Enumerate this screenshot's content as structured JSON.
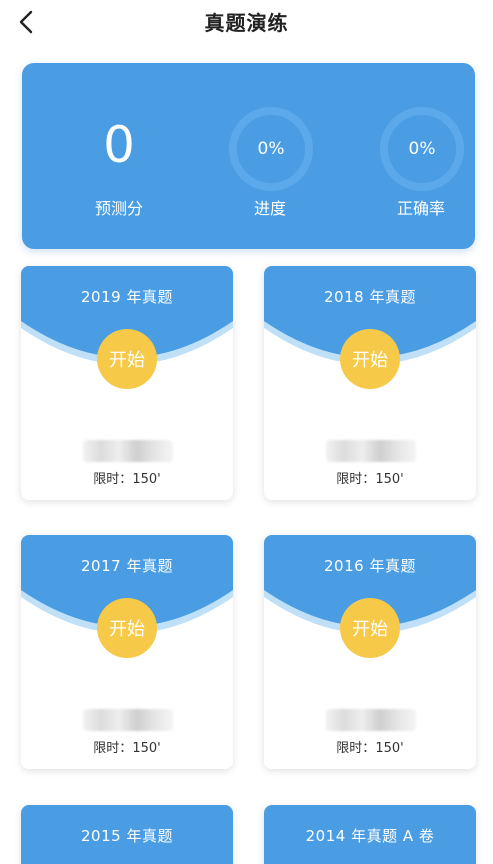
{
  "header": {
    "title": "真题演练"
  },
  "stats": {
    "score_value": "0",
    "score_label": "预测分",
    "progress_value": "0%",
    "progress_label": "进度",
    "accuracy_value": "0%",
    "accuracy_label": "正确率"
  },
  "exams": [
    {
      "title": "2019 年真题",
      "start_label": "开始",
      "time_label": "限时：",
      "time_value": "150'"
    },
    {
      "title": "2018 年真题",
      "start_label": "开始",
      "time_label": "限时：",
      "time_value": "150'"
    },
    {
      "title": "2017 年真题",
      "start_label": "开始",
      "time_label": "限时：",
      "time_value": "150'"
    },
    {
      "title": "2016 年真题",
      "start_label": "开始",
      "time_label": "限时：",
      "time_value": "150'"
    },
    {
      "title": "2015 年真题"
    },
    {
      "title": "2014 年真题 A 卷"
    }
  ],
  "colors": {
    "primary_blue": "#4a9de3",
    "start_yellow": "#f7c948",
    "arc_light": "#bfe0f7"
  }
}
